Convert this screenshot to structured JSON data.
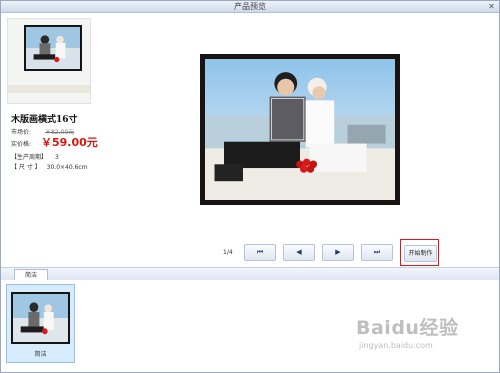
{
  "window": {
    "title": "产品预览",
    "close_glyph": "✕"
  },
  "product": {
    "name": "木版画横式16寸",
    "market_price_label": "市场价:",
    "market_price": "￥82.00元",
    "member_price_label": "实价格:",
    "member_price": "￥59.00元",
    "cycle_label": "【生产周期】",
    "cycle_value": "3",
    "size_label": "【 尺  寸 】",
    "size_value": "30.0×40.6cm"
  },
  "pager": {
    "text": "1/4"
  },
  "nav": {
    "first": "⏮",
    "prev": "◀",
    "next": "▶",
    "last": "⏭"
  },
  "make_button": "开始制作",
  "tabs": [
    {
      "label": "简洁"
    }
  ],
  "thumbnails": [
    {
      "label": "简洁",
      "selected": true
    }
  ],
  "watermark": {
    "logo": "Baidu经验",
    "url": "jingyan.baidu.com"
  },
  "colors": {
    "price": "#d4170f",
    "highlight": "#e0141a",
    "selection": "#d6ebfb"
  }
}
